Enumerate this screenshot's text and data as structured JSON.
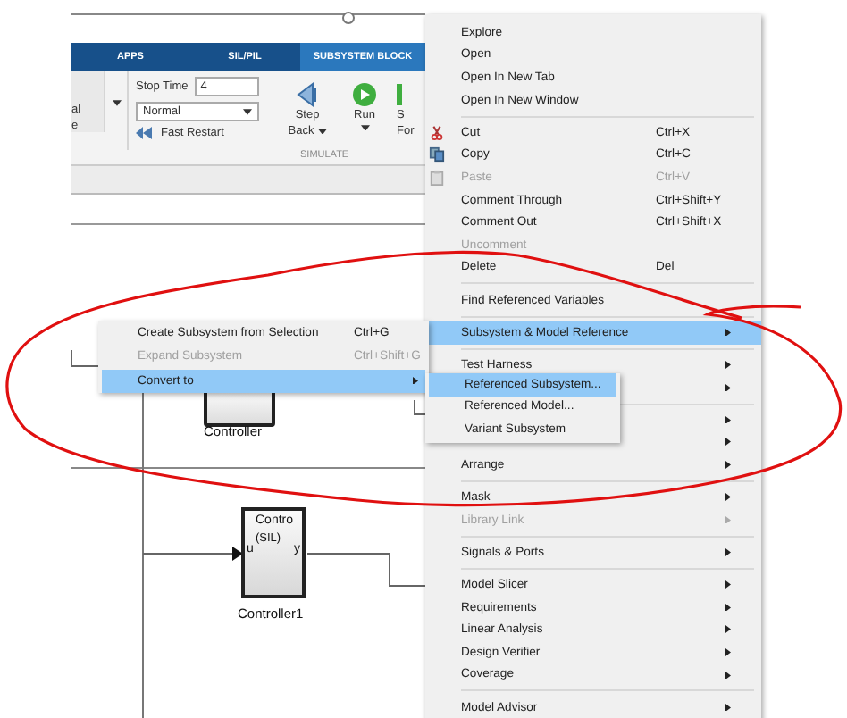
{
  "toolstrip": {
    "tabs": [
      {
        "label": "APPS",
        "selected": false
      },
      {
        "label": "SIL/PIL",
        "selected": false
      },
      {
        "label": "SUBSYSTEM BLOCK",
        "selected": true
      }
    ],
    "left_button_partial": [
      "al",
      "e"
    ],
    "stop_time": {
      "label": "Stop Time",
      "value": "4"
    },
    "mode": {
      "value": "Normal"
    },
    "fast_restart": "Fast Restart",
    "step_back": [
      "Step",
      "Back"
    ],
    "run": "Run",
    "step_forward_partial": [
      "S",
      "For"
    ],
    "section_label": "SIMULATE"
  },
  "canvas": {
    "blocks": [
      {
        "kind": "plain",
        "name": "Controller"
      },
      {
        "kind": "sil",
        "name": "Controller1",
        "title": "Contro",
        "tag": "(SIL)",
        "input": "u",
        "output": "y"
      }
    ]
  },
  "context_menu": {
    "items": [
      {
        "kind": "item",
        "label": "Explore",
        "disabled": false,
        "selected": false,
        "submenu": false
      },
      {
        "kind": "item",
        "label": "Open",
        "disabled": false,
        "selected": false,
        "submenu": false
      },
      {
        "kind": "item",
        "label": "Open In New Tab",
        "disabled": false,
        "selected": false,
        "submenu": false
      },
      {
        "kind": "item",
        "label": "Open In New Window",
        "disabled": false,
        "selected": false,
        "submenu": false
      },
      {
        "kind": "separator"
      },
      {
        "kind": "item",
        "label": "Cut",
        "shortcut": "Ctrl+X",
        "disabled": false,
        "selected": false,
        "submenu": false
      },
      {
        "kind": "item",
        "label": "Copy",
        "shortcut": "Ctrl+C",
        "disabled": false,
        "selected": false,
        "submenu": false
      },
      {
        "kind": "item",
        "label": "Paste",
        "shortcut": "Ctrl+V",
        "disabled": true,
        "selected": false,
        "submenu": false
      },
      {
        "kind": "item",
        "label": "Comment Through",
        "shortcut": "Ctrl+Shift+Y",
        "disabled": false,
        "selected": false,
        "submenu": false
      },
      {
        "kind": "item",
        "label": "Comment Out",
        "shortcut": "Ctrl+Shift+X",
        "disabled": false,
        "selected": false,
        "submenu": false
      },
      {
        "kind": "item",
        "label": "Uncomment",
        "disabled": true,
        "selected": false,
        "submenu": false
      },
      {
        "kind": "item",
        "label": "Delete",
        "shortcut": "Del",
        "disabled": false,
        "selected": false,
        "submenu": false
      },
      {
        "kind": "separator"
      },
      {
        "kind": "item",
        "label": "Find Referenced Variables",
        "disabled": false,
        "selected": false,
        "submenu": false
      },
      {
        "kind": "separator"
      },
      {
        "kind": "item",
        "label": "Subsystem & Model Reference",
        "disabled": false,
        "selected": true,
        "submenu": true
      },
      {
        "kind": "separator"
      },
      {
        "kind": "item",
        "label": "Test Harness",
        "disabled": false,
        "selected": false,
        "submenu": true
      },
      {
        "kind": "covered",
        "submenu": true
      },
      {
        "kind": "separator"
      },
      {
        "kind": "covered",
        "submenu": true
      },
      {
        "kind": "covered",
        "submenu": true
      },
      {
        "kind": "item",
        "label": "Arrange",
        "disabled": false,
        "selected": false,
        "submenu": true
      },
      {
        "kind": "separator"
      },
      {
        "kind": "item",
        "label": "Mask",
        "disabled": false,
        "selected": false,
        "submenu": true
      },
      {
        "kind": "item",
        "label": "Library Link",
        "disabled": true,
        "selected": false,
        "submenu": true
      },
      {
        "kind": "separator"
      },
      {
        "kind": "item",
        "label": "Signals & Ports",
        "disabled": false,
        "selected": false,
        "submenu": true
      },
      {
        "kind": "separator"
      },
      {
        "kind": "item",
        "label": "Model Slicer",
        "disabled": false,
        "selected": false,
        "submenu": true
      },
      {
        "kind": "item",
        "label": "Requirements",
        "disabled": false,
        "selected": false,
        "submenu": true
      },
      {
        "kind": "item",
        "label": "Linear Analysis",
        "disabled": false,
        "selected": false,
        "submenu": true
      },
      {
        "kind": "item",
        "label": "Design Verifier",
        "disabled": false,
        "selected": false,
        "submenu": true
      },
      {
        "kind": "item",
        "label": "Coverage",
        "disabled": false,
        "selected": false,
        "submenu": true
      },
      {
        "kind": "separator"
      },
      {
        "kind": "item",
        "label": "Model Advisor",
        "disabled": false,
        "selected": false,
        "submenu": true
      }
    ]
  },
  "subsystem_menu": {
    "items": [
      {
        "kind": "item",
        "label": "Create Subsystem from Selection",
        "shortcut": "Ctrl+G",
        "disabled": false,
        "selected": false,
        "submenu": false
      },
      {
        "kind": "item",
        "label": "Expand Subsystem",
        "shortcut": "Ctrl+Shift+G",
        "disabled": true,
        "selected": false,
        "submenu": false
      },
      {
        "kind": "item",
        "label": "Convert to",
        "disabled": false,
        "selected": true,
        "submenu": true
      }
    ]
  },
  "convert_menu": {
    "items": [
      {
        "kind": "item",
        "label": "Referenced Subsystem...",
        "disabled": false,
        "selected": true,
        "submenu": false
      },
      {
        "kind": "item",
        "label": "Referenced Model...",
        "disabled": false,
        "selected": false,
        "submenu": false
      },
      {
        "kind": "item",
        "label": "Variant Subsystem",
        "disabled": false,
        "selected": false,
        "submenu": false
      }
    ]
  }
}
